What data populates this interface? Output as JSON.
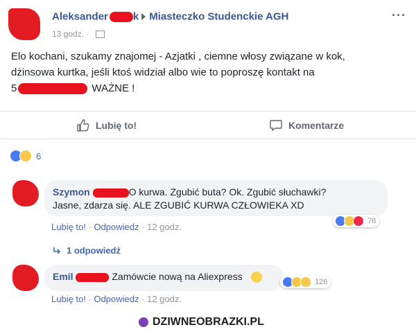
{
  "post": {
    "author_visible": "Aleksander",
    "group": "Miasteczko Studenckie AGH",
    "time": "13 godz.",
    "text_line1": "Elo kochani, szukamy znajomej - Azjatki , ciemne włosy związane w kok,",
    "text_line2": "dżinsowa kurtka, jeśli ktoś widział albo wie to poproszę kontakt na",
    "text_line3_prefix": "5",
    "text_line3_suffix": "WAŻNE !",
    "like_label": "Lubię to!",
    "comment_label": "Komentarze",
    "reaction_count": "6"
  },
  "comments": [
    {
      "name": "Szymon",
      "text_line1": "O kurwa. Zgubić buta? Ok. Zgubić słuchawki?",
      "text_line2": "Jasne, zdarza się. ALE ZGUBIĆ KURWA CZŁOWIEKA XD",
      "like": "Lubię to!",
      "reply": "Odpowiedz",
      "time": "12 godz.",
      "reactions": "78"
    },
    {
      "name": "Emil",
      "text": "Zamówcie nową na Aliexpress",
      "like": "Lubię to!",
      "reply": "Odpowiedz",
      "time": "12 godz.",
      "reactions": "126"
    }
  ],
  "replies_label": "1 odpowiedź",
  "separator": "·",
  "watermark": "DZIWNEOBRAZKI.PL",
  "colors": {
    "link": "#365899",
    "redaction": "#e8121f",
    "like_blue": "#4a7af2"
  }
}
